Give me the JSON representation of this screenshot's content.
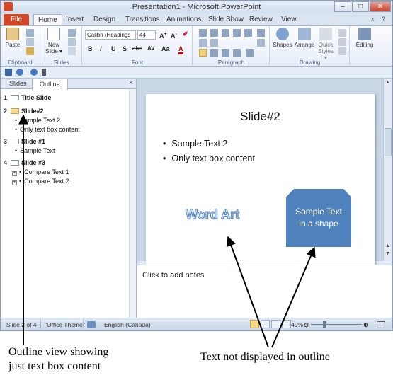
{
  "window": {
    "title": "Presentation1 - Microsoft PowerPoint",
    "win_min": "–",
    "win_max": "□",
    "win_close": "✕"
  },
  "tabs": {
    "file": "File",
    "items": [
      "Home",
      "Insert",
      "Design",
      "Transitions",
      "Animations",
      "Slide Show",
      "Review",
      "View"
    ],
    "active": "Home"
  },
  "ribbon": {
    "clipboard": {
      "label": "Clipboard",
      "paste": "Paste"
    },
    "slides": {
      "label": "Slides",
      "new_slide_1": "New",
      "new_slide_2": "Slide ▾"
    },
    "font": {
      "label": "Font",
      "family": "Calibri (Headings",
      "size": "44",
      "bold": "B",
      "italic": "I",
      "underline": "U",
      "strike": "S",
      "shadow": "abc",
      "spacing": "AV",
      "case": "Aa",
      "color": "A"
    },
    "paragraph": {
      "label": "Paragraph"
    },
    "drawing": {
      "label": "Drawing",
      "shapes": "Shapes",
      "arrange": "Arrange",
      "quick_styles_1": "Quick",
      "quick_styles_2": "Styles ▾"
    },
    "editing": {
      "label": "Editing"
    }
  },
  "left_pane": {
    "tab_slides": "Slides",
    "tab_outline": "Outline",
    "close": "×",
    "outline": [
      {
        "num": "1",
        "title": "Title Slide",
        "items": []
      },
      {
        "num": "2",
        "title": "Slide#2",
        "items": [
          "Sample Text 2",
          "Only text box content"
        ]
      },
      {
        "num": "3",
        "title": "Slide #1",
        "items": [
          "Sample Text"
        ]
      },
      {
        "num": "4",
        "title": "Slide #3",
        "items": [
          "Compare Text 1",
          "Compare Text 2"
        ]
      }
    ]
  },
  "slide": {
    "title": "Slide#2",
    "bullets": [
      "Sample Text 2",
      "Only text box content"
    ],
    "wordart": "Word Art",
    "shape_text": "Sample Text in a shape"
  },
  "notes": {
    "placeholder": "Click to add notes"
  },
  "status": {
    "slide_info": "Slide 2 of 4",
    "theme": "\"Office Theme\"",
    "language": "English (Canada)",
    "zoom": "49%"
  },
  "annotations": {
    "left_line1": "Outline view showing",
    "left_line2": "just text box content",
    "right": "Text not displayed in outline"
  },
  "colors": {
    "file_tab": "#d24726",
    "shape_fill": "#4f81bd",
    "slide_bg": "#c9d6e6"
  }
}
